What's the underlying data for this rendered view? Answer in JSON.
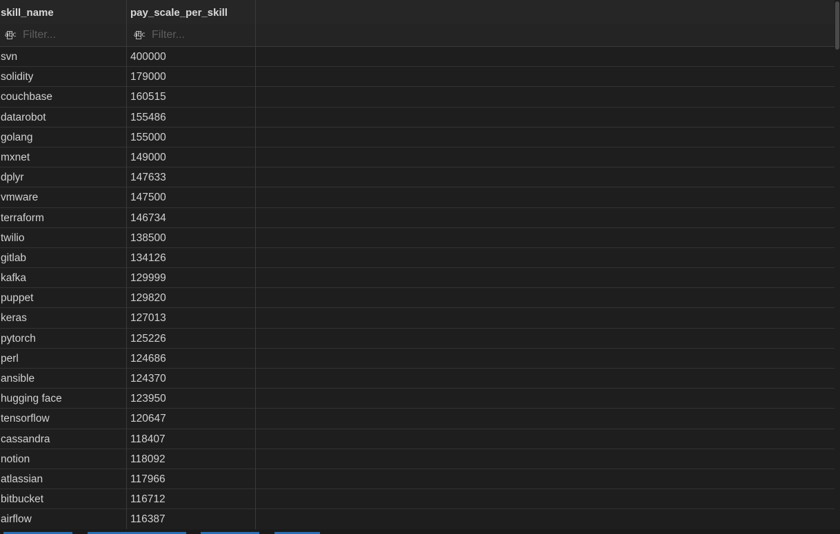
{
  "columns": [
    {
      "name": "skill_name",
      "filter_placeholder": "Filter..."
    },
    {
      "name": "pay_scale_per_skill",
      "filter_placeholder": "Filter..."
    }
  ],
  "filter_icon": "abc-text-type-icon",
  "rows": [
    {
      "skill_name": "svn",
      "pay_scale_per_skill": "400000"
    },
    {
      "skill_name": "solidity",
      "pay_scale_per_skill": "179000"
    },
    {
      "skill_name": "couchbase",
      "pay_scale_per_skill": "160515"
    },
    {
      "skill_name": "datarobot",
      "pay_scale_per_skill": "155486"
    },
    {
      "skill_name": "golang",
      "pay_scale_per_skill": "155000"
    },
    {
      "skill_name": "mxnet",
      "pay_scale_per_skill": "149000"
    },
    {
      "skill_name": "dplyr",
      "pay_scale_per_skill": "147633"
    },
    {
      "skill_name": "vmware",
      "pay_scale_per_skill": "147500"
    },
    {
      "skill_name": "terraform",
      "pay_scale_per_skill": "146734"
    },
    {
      "skill_name": "twilio",
      "pay_scale_per_skill": "138500"
    },
    {
      "skill_name": "gitlab",
      "pay_scale_per_skill": "134126"
    },
    {
      "skill_name": "kafka",
      "pay_scale_per_skill": "129999"
    },
    {
      "skill_name": "puppet",
      "pay_scale_per_skill": "129820"
    },
    {
      "skill_name": "keras",
      "pay_scale_per_skill": "127013"
    },
    {
      "skill_name": "pytorch",
      "pay_scale_per_skill": "125226"
    },
    {
      "skill_name": "perl",
      "pay_scale_per_skill": "124686"
    },
    {
      "skill_name": "ansible",
      "pay_scale_per_skill": "124370"
    },
    {
      "skill_name": "hugging face",
      "pay_scale_per_skill": "123950"
    },
    {
      "skill_name": "tensorflow",
      "pay_scale_per_skill": "120647"
    },
    {
      "skill_name": "cassandra",
      "pay_scale_per_skill": "118407"
    },
    {
      "skill_name": "notion",
      "pay_scale_per_skill": "118092"
    },
    {
      "skill_name": "atlassian",
      "pay_scale_per_skill": "117966"
    },
    {
      "skill_name": "bitbucket",
      "pay_scale_per_skill": "116712"
    },
    {
      "skill_name": "airflow",
      "pay_scale_per_skill": "116387"
    }
  ],
  "colors": {
    "background": "#1e1e1e",
    "header_background": "#262626",
    "grid_line": "#333333",
    "text": "#d2d2d2",
    "placeholder": "#5e5e5e",
    "accent": "#2a6fb0"
  }
}
